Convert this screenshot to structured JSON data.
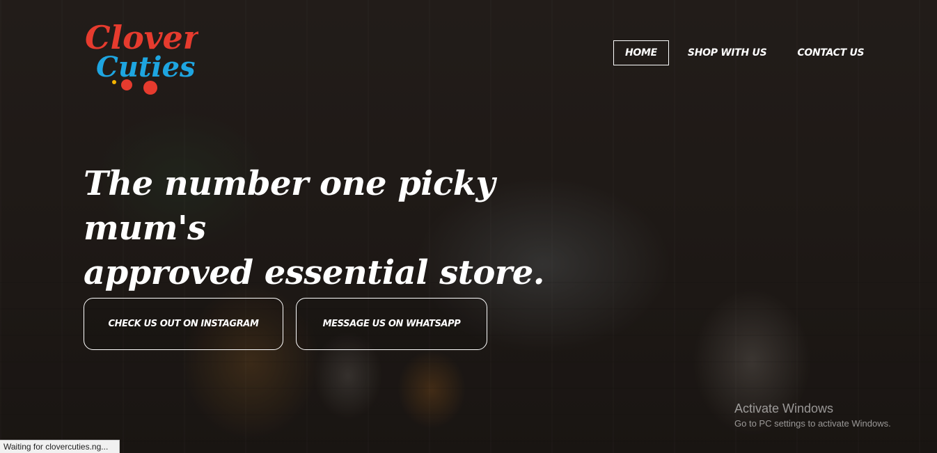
{
  "logo": {
    "line1": "Clover",
    "line2": "Cuties",
    "colors": [
      "#e63b2e",
      "#f4b400",
      "#1ea5e0",
      "#7bc043",
      "#e03d8a"
    ]
  },
  "nav": {
    "items": [
      {
        "label": "HOME",
        "active": true
      },
      {
        "label": "SHOP WITH US",
        "active": false
      },
      {
        "label": "CONTACT US",
        "active": false
      }
    ]
  },
  "hero": {
    "headline_line1": "The number one picky mum's",
    "headline_line2": "approved essential store.",
    "cta_instagram": "CHECK US OUT ON INSTAGRAM",
    "cta_whatsapp": "MESSAGE US ON WHATSAPP"
  },
  "watermark": {
    "title": "Activate Windows",
    "subtitle": "Go to PC settings to activate Windows."
  },
  "status_bar": {
    "text": "Waiting for clovercuties.ng..."
  }
}
